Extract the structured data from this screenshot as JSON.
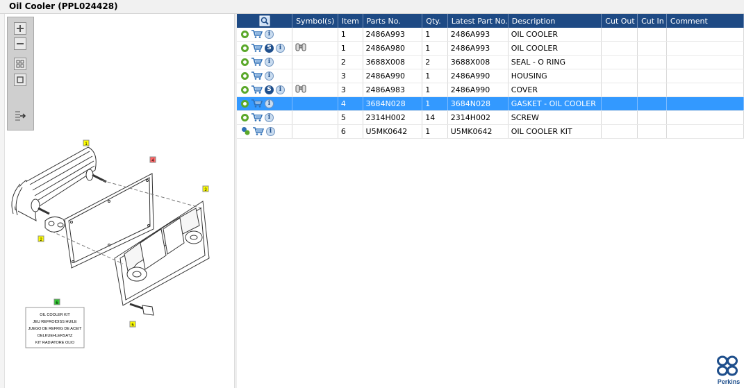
{
  "window": {
    "title": "Oil Cooler (PPL024428)"
  },
  "toolbar": {
    "buttons": [
      {
        "name": "zoom-in-button",
        "icon": "plus-icon"
      },
      {
        "name": "zoom-out-button",
        "icon": "minus-icon"
      },
      {
        "name": "fit-all-button",
        "icon": "grid-icon"
      },
      {
        "name": "fit-page-button",
        "icon": "square-icon"
      },
      {
        "name": "export-button",
        "icon": "export-arrow-icon"
      }
    ]
  },
  "diagram": {
    "callouts": [
      "1",
      "4",
      "3",
      "2",
      "6",
      "5"
    ],
    "kit_box_lines": [
      "OIL COOLER KIT",
      "JEU REFROIDISS HUILE",
      "JUEGO DE REFRIG DE ACEIT",
      "OELKUEHLERSATZ",
      "KIT RADIATORE OLIO"
    ],
    "callout_colors": {
      "default": "#ffff00",
      "selected": "#ff6666",
      "kit": "#33cc33"
    }
  },
  "grid": {
    "columns": [
      "",
      "Symbol(s)",
      "Item",
      "Parts No.",
      "Qty.",
      "Latest Part No.",
      "Description",
      "Cut Out",
      "Cut In",
      "Comment"
    ],
    "header_color": "#1e4a84",
    "selected_color": "#3399ff",
    "rows": [
      {
        "icons": [
          "gear-icon",
          "cart-icon",
          "info-icon"
        ],
        "symbol": "",
        "item": "1",
        "part": "2486A993",
        "qty": "1",
        "latest": "2486A993",
        "desc": "OIL COOLER",
        "cut_out": "",
        "cut_in": "",
        "comment": "",
        "selected": false
      },
      {
        "icons": [
          "gear-icon",
          "cart-icon",
          "s-icon",
          "info-icon"
        ],
        "symbol": "binoculars-icon",
        "item": "1",
        "part": "2486A980",
        "qty": "1",
        "latest": "2486A993",
        "desc": "OIL COOLER",
        "cut_out": "",
        "cut_in": "",
        "comment": "",
        "selected": false
      },
      {
        "icons": [
          "gear-icon",
          "cart-icon",
          "info-icon"
        ],
        "symbol": "",
        "item": "2",
        "part": "3688X008",
        "qty": "2",
        "latest": "3688X008",
        "desc": "SEAL - O RING",
        "cut_out": "",
        "cut_in": "",
        "comment": "",
        "selected": false
      },
      {
        "icons": [
          "gear-icon",
          "cart-icon",
          "info-icon"
        ],
        "symbol": "",
        "item": "3",
        "part": "2486A990",
        "qty": "1",
        "latest": "2486A990",
        "desc": "HOUSING",
        "cut_out": "",
        "cut_in": "",
        "comment": "",
        "selected": false
      },
      {
        "icons": [
          "gear-icon",
          "cart-icon",
          "s-icon",
          "info-icon"
        ],
        "symbol": "binoculars-icon",
        "item": "3",
        "part": "2486A983",
        "qty": "1",
        "latest": "2486A990",
        "desc": "COVER",
        "cut_out": "",
        "cut_in": "",
        "comment": "",
        "selected": false
      },
      {
        "icons": [
          "gear-icon",
          "cart-icon",
          "info-icon"
        ],
        "symbol": "",
        "item": "4",
        "part": "3684N028",
        "qty": "1",
        "latest": "3684N028",
        "desc": "GASKET - OIL COOLER",
        "cut_out": "",
        "cut_in": "",
        "comment": "",
        "selected": true
      },
      {
        "icons": [
          "gear-icon",
          "cart-icon",
          "info-icon"
        ],
        "symbol": "",
        "item": "5",
        "part": "2314H002",
        "qty": "14",
        "latest": "2314H002",
        "desc": "SCREW",
        "cut_out": "",
        "cut_in": "",
        "comment": "",
        "selected": false
      },
      {
        "icons": [
          "gears-icon",
          "cart-icon",
          "info-icon"
        ],
        "symbol": "",
        "item": "6",
        "part": "U5MK0642",
        "qty": "1",
        "latest": "U5MK0642",
        "desc": "OIL COOLER KIT",
        "cut_out": "",
        "cut_in": "",
        "comment": "",
        "selected": false
      }
    ]
  },
  "brand": {
    "name": "Perkins",
    "color": "#1f4f8c"
  }
}
